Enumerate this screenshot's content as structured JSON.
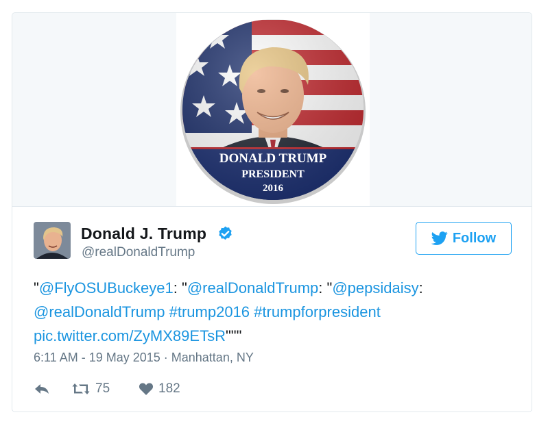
{
  "media": {
    "button_line1": "DONALD TRUMP",
    "button_line2": "PRESIDENT",
    "button_line3": "2016"
  },
  "user": {
    "display_name": "Donald J. Trump",
    "handle": "@realDonaldTrump",
    "verified": true
  },
  "follow_label": "Follow",
  "tweet": {
    "q1": "\"",
    "link1": "@FlyOSUBuckeye1",
    "sep1": ": \"",
    "link2": "@realDonaldTrump",
    "sep2": ": \"",
    "link3": "@pepsidaisy",
    "sep3": ":",
    "link4": "@realDonaldTrump",
    "sp1": " ",
    "link5": "#trump2016",
    "sp2": " ",
    "link6": "#trumpforpresident",
    "link7": "pic.twitter.com/ZyMX89ETsR",
    "end": "\"\"\""
  },
  "meta": {
    "text": "6:11 AM - 19 May 2015 · Manhattan, NY"
  },
  "actions": {
    "retweets": "75",
    "likes": "182"
  },
  "colors": {
    "link": "#1b95e0",
    "accent": "#1da1f2",
    "muted": "#657786",
    "text": "#14171a"
  }
}
